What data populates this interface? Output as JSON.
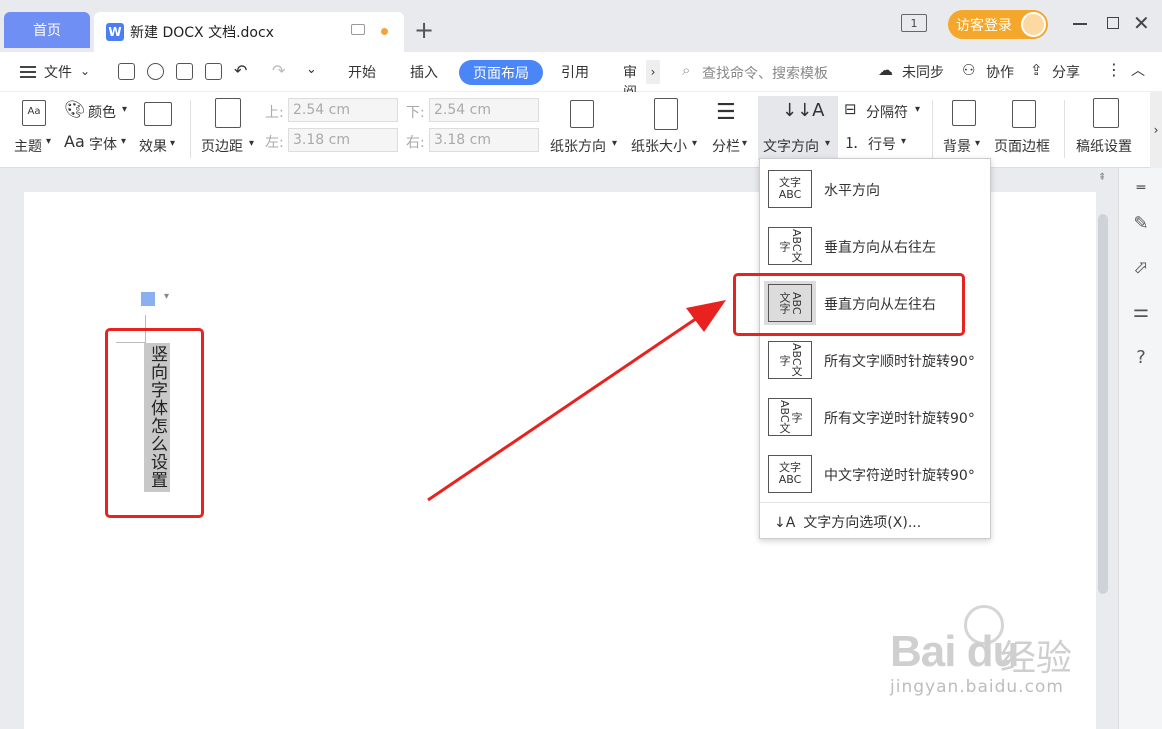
{
  "titlebar": {
    "home_tab": "首页",
    "doc_tab": "新建 DOCX 文档.docx",
    "logo_letter": "W",
    "new_tab": "+",
    "page_count": "1",
    "login": "访客登录",
    "close": "✕"
  },
  "menubar": {
    "file": "文件",
    "tabs": [
      "开始",
      "插入",
      "页面布局",
      "引用",
      "审阅"
    ],
    "active_tab": "页面布局",
    "search": "查找命令、搜索模板",
    "sync": "未同步",
    "collab": "协作",
    "share": "分享"
  },
  "ribbon": {
    "theme": "主题",
    "color": "颜色",
    "font": "字体",
    "effect": "效果",
    "margins": "页边距",
    "top_label": "上:",
    "top_value": "2.54 cm",
    "bottom_label": "下:",
    "bottom_value": "2.54 cm",
    "left_label": "左:",
    "left_value": "3.18 cm",
    "right_label": "右:",
    "right_value": "3.18 cm",
    "orientation": "纸张方向",
    "size": "纸张大小",
    "columns": "分栏",
    "text_direction": "文字方向",
    "separator": "分隔符",
    "line_number": "行号",
    "background": "背景",
    "page_border": "页面边框",
    "grid_paper": "稿纸设置"
  },
  "document": {
    "vertical_text": "竖向字体怎么设置"
  },
  "text_direction_menu": {
    "items": [
      {
        "label": "水平方向",
        "icon": "文字ABC"
      },
      {
        "label": "垂直方向从右往左",
        "icon": "ABC文字"
      },
      {
        "label": "垂直方向从左往右",
        "icon": "文字ABC"
      },
      {
        "label": "所有文字顺时针旋转90°",
        "icon": "ABC文字"
      },
      {
        "label": "所有文字逆时针旋转90°",
        "icon": "ABC文字"
      },
      {
        "label": "中文字符逆时针旋转90°",
        "icon": "文字ABC"
      }
    ],
    "options": "文字方向选项(X)..."
  },
  "watermark": {
    "logo": "Bai du",
    "jingyan": "经验",
    "url": "jingyan.baidu.com"
  },
  "colors": {
    "accent": "#4a86f7",
    "annotation_red": "#e8231f",
    "login_orange": "#f4a72b"
  }
}
